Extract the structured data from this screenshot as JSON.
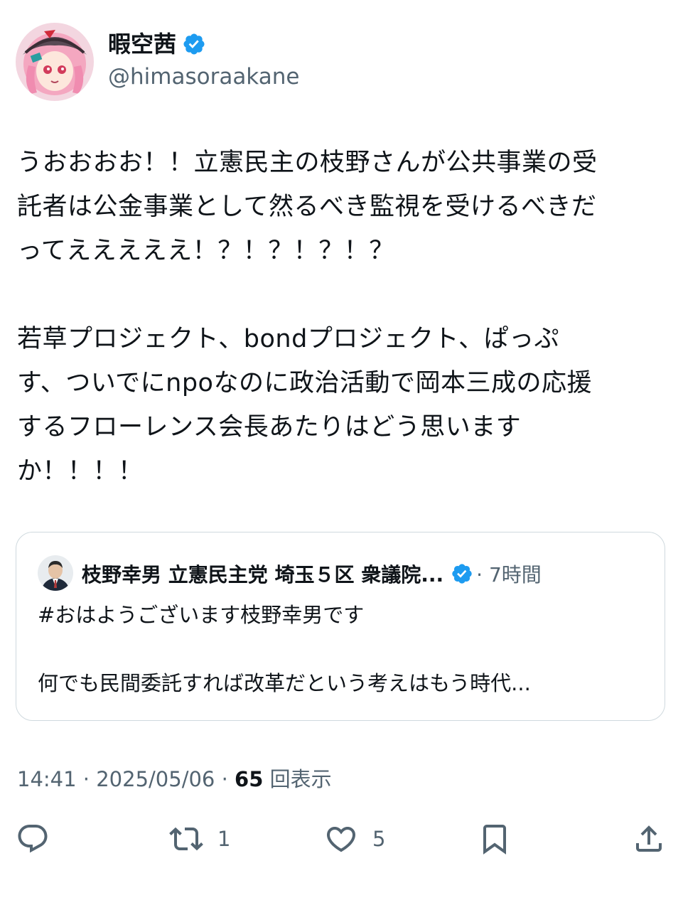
{
  "author": {
    "display_name": "暇空茜",
    "handle": "@himasoraakane",
    "verified": true,
    "verified_color": "#1d9bf0"
  },
  "tweet": {
    "paragraph1": [
      "うおおおお！！立憲民主の枝野さんが公共事業の受",
      "託者は公金事業として然るべき監視を受けるべきだ",
      "ってえええええ！？！？！？！？"
    ],
    "paragraph2": [
      "若草プロジェクト、bondプロジェクト、ぱっぷ",
      "す、ついでにnpoなのに政治活動で岡本三成の応援",
      "するフローレンス会長あたりはどう思います",
      "か！！！！"
    ]
  },
  "quote": {
    "name": "枝野幸男 立憲民主党 埼玉５区 衆議院...",
    "verified": true,
    "time": "· 7時間",
    "line1": "#おはようございます枝野幸男です",
    "line2": "何でも民間委託すれば改革だという考えはもう時代..."
  },
  "meta": {
    "time": "14:41",
    "sep1": " · ",
    "date": "2025/05/06",
    "sep2": " · ",
    "views": "65",
    "views_label": " 回表示"
  },
  "actions": {
    "reply_icon": "reply-icon",
    "retweet_icon": "retweet-icon",
    "retweet_count": "1",
    "like_icon": "heart-icon",
    "like_count": "5",
    "bookmark_icon": "bookmark-icon",
    "share_icon": "share-icon"
  },
  "colors": {
    "text": "#0f1419",
    "secondary": "#536471",
    "border": "#cfd9de",
    "verified": "#1d9bf0"
  }
}
